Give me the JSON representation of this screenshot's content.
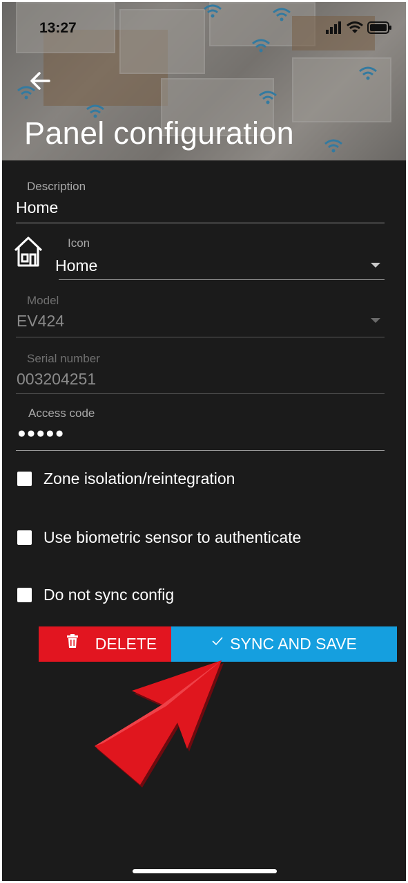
{
  "status_bar": {
    "time": "13:27"
  },
  "header": {
    "title": "Panel configuration"
  },
  "form": {
    "description": {
      "label": "Description",
      "value": "Home"
    },
    "icon": {
      "label": "Icon",
      "value": "Home"
    },
    "model": {
      "label": "Model",
      "value": "EV424"
    },
    "serial": {
      "label": "Serial number",
      "value": "003204251"
    },
    "access_code": {
      "label": "Access code",
      "value": "●●●●●"
    }
  },
  "options": [
    {
      "label": "Zone isolation/reintegration",
      "checked": false
    },
    {
      "label": "Use biometric sensor to authenticate",
      "checked": false
    },
    {
      "label": "Do not sync config",
      "checked": false
    }
  ],
  "actions": {
    "delete_label": "DELETE",
    "sync_label": "SYNC AND SAVE"
  },
  "colors": {
    "background": "#1b1b1b",
    "delete": "#e21520",
    "sync": "#159fdf",
    "arrow": "#e0161e"
  },
  "icons": [
    "back-arrow-icon",
    "home-icon",
    "trash-icon",
    "check-icon",
    "signal-icon",
    "wifi-icon",
    "battery-icon",
    "pointer-arrow-icon"
  ]
}
